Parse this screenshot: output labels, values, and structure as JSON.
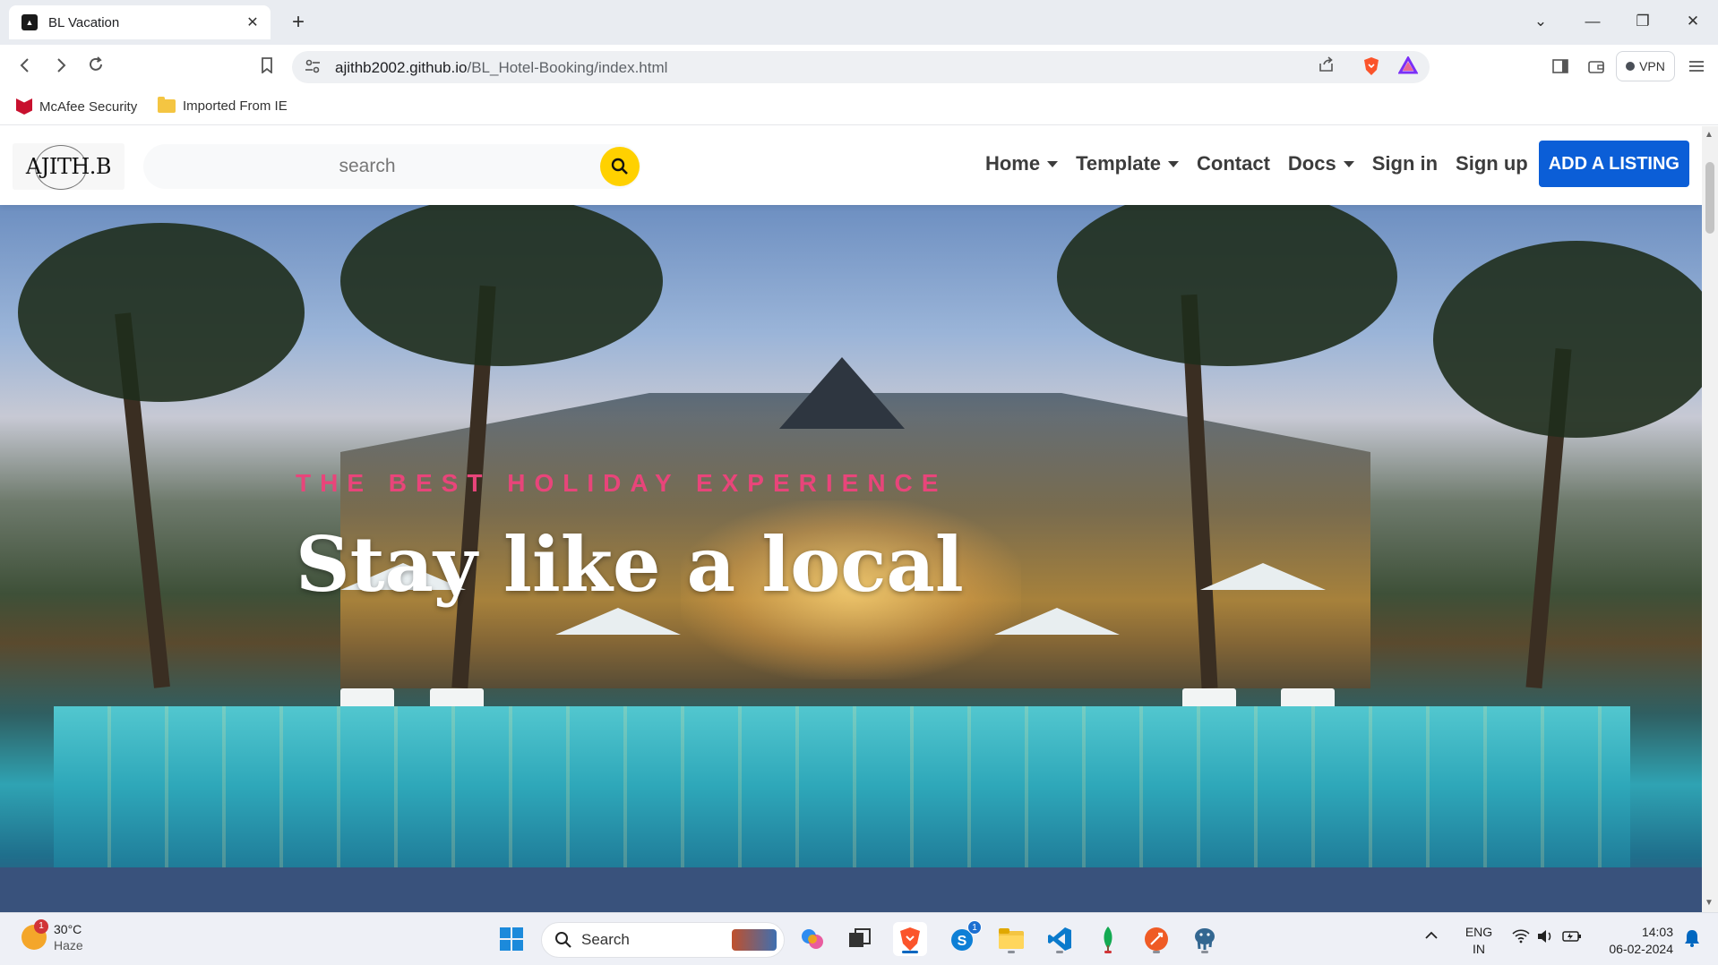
{
  "browser": {
    "tab_title": "BL Vacation",
    "tab_close": "✕",
    "new_tab": "+",
    "url_host": "ajithb2002.github.io",
    "url_path": "/BL_Hotel-Booking/index.html",
    "vpn_label": "VPN",
    "window_controls": {
      "list": "⌄",
      "minimize": "—",
      "restore": "❐",
      "close": "✕"
    }
  },
  "bookmarks": [
    {
      "label": "McAfee Security",
      "icon": "mcafee-icon"
    },
    {
      "label": "Imported From IE",
      "icon": "folder-icon"
    }
  ],
  "site": {
    "logo_text": "AJITH.B",
    "search_placeholder": "search",
    "nav": {
      "home": "Home",
      "template": "Template",
      "contact": "Contact",
      "docs": "Docs",
      "signin": "Sign in",
      "signup": "Sign up",
      "add_listing": "ADD A LISTING"
    },
    "hero": {
      "subtitle": "THE BEST HOLIDAY EXPERIENCE",
      "title": "Stay like a local"
    },
    "colors": {
      "accent_pink": "#e8457a",
      "search_button": "#ffd100",
      "listing_button": "#0b5ed7"
    }
  },
  "taskbar": {
    "weather_temp": "30°C",
    "weather_condition": "Haze",
    "weather_badge": "1",
    "search_label": "Search",
    "skype_badge": "1",
    "lang_top": "ENG",
    "lang_bottom": "IN",
    "time": "14:03",
    "date": "06-02-2024"
  }
}
